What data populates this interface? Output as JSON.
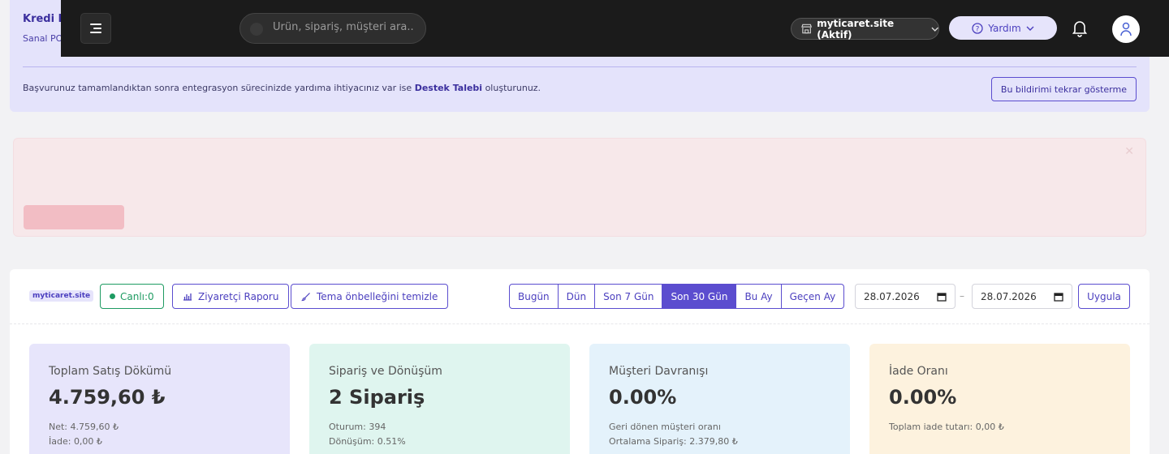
{
  "notice": {
    "title": "Kredi ka",
    "subtitle": "Sanal PO",
    "message_prefix": "Başvurunuz tamamlandıktan sonra entegrasyon sürecinizde yardıma ihtiyacınız var ise ",
    "message_link": "Destek Talebi",
    "message_suffix": " oluşturunuz.",
    "dismiss_button": "Bu bildirimi tekrar gösterme"
  },
  "topbar": {
    "search_placeholder": "Ürün, sipariş, müşteri ara..",
    "store_label": "myticaret.site (Aktif)",
    "help_label": "Yardım"
  },
  "dashboard": {
    "site_badge": "myticaret.site",
    "live_label": "Canlı:0",
    "visitor_report": "Ziyaretçi Raporu",
    "clear_cache": "Tema önbelleğini temizle",
    "ranges": [
      "Bugün",
      "Dün",
      "Son 7 Gün",
      "Son 30 Gün",
      "Bu Ay",
      "Geçen Ay"
    ],
    "active_range": "Son 30 Gün",
    "date_from": "28.07.2026",
    "date_to": "28.07.2026",
    "date_separator": "–",
    "apply": "Uygula",
    "stats": [
      {
        "title": "Toplam Satış Dökümü",
        "value": "4.759,60 ₺",
        "line1": "Net: 4.759,60 ₺",
        "line2": "İade: 0,00 ₺",
        "bg": "#e7e5fb"
      },
      {
        "title": "Sipariş ve Dönüşüm",
        "value": "2 Sipariş",
        "line1": "Oturum: 394",
        "line2": "Dönüşüm: 0.51%",
        "bg": "#dff5ef"
      },
      {
        "title": "Müşteri Davranışı",
        "value": "0.00%",
        "line1": "Geri dönen müşteri oranı",
        "line2": "Ortalama Sipariş: 2.379,80 ₺",
        "bg": "#e4f2fb"
      },
      {
        "title": "İade Oranı",
        "value": "0.00%",
        "line1": "Toplam iade tutarı: 0,00 ₺",
        "line2": "",
        "bg": "#fdf2de"
      }
    ]
  },
  "colors": {
    "accent": "#5b4dcf",
    "topbar": "#1b1b1b",
    "success": "#1e9b62"
  }
}
